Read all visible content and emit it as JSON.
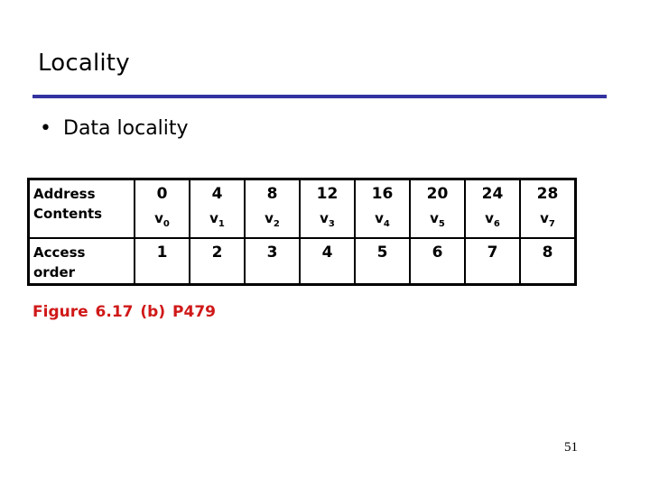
{
  "slide": {
    "title": "Locality",
    "bullet": "Data locality",
    "bullet_icon": "bullet-dot",
    "rule_color": "#3333a0",
    "caption": "Figure 6.17 (b)  P479",
    "caption_color": "#d01818",
    "page_number": "51"
  },
  "table": {
    "row1_header": [
      "Address",
      "Contents"
    ],
    "row2_header": [
      "Access",
      "order"
    ],
    "columns": [
      {
        "address": "0",
        "content": "v",
        "sub": "0",
        "order": "1"
      },
      {
        "address": "4",
        "content": "v",
        "sub": "1",
        "order": "2"
      },
      {
        "address": "8",
        "content": "v",
        "sub": "2",
        "order": "3"
      },
      {
        "address": "12",
        "content": "v",
        "sub": "3",
        "order": "4"
      },
      {
        "address": "16",
        "content": "v",
        "sub": "4",
        "order": "5"
      },
      {
        "address": "20",
        "content": "v",
        "sub": "5",
        "order": "6"
      },
      {
        "address": "24",
        "content": "v",
        "sub": "6",
        "order": "7"
      },
      {
        "address": "28",
        "content": "v",
        "sub": "7",
        "order": "8"
      }
    ]
  }
}
